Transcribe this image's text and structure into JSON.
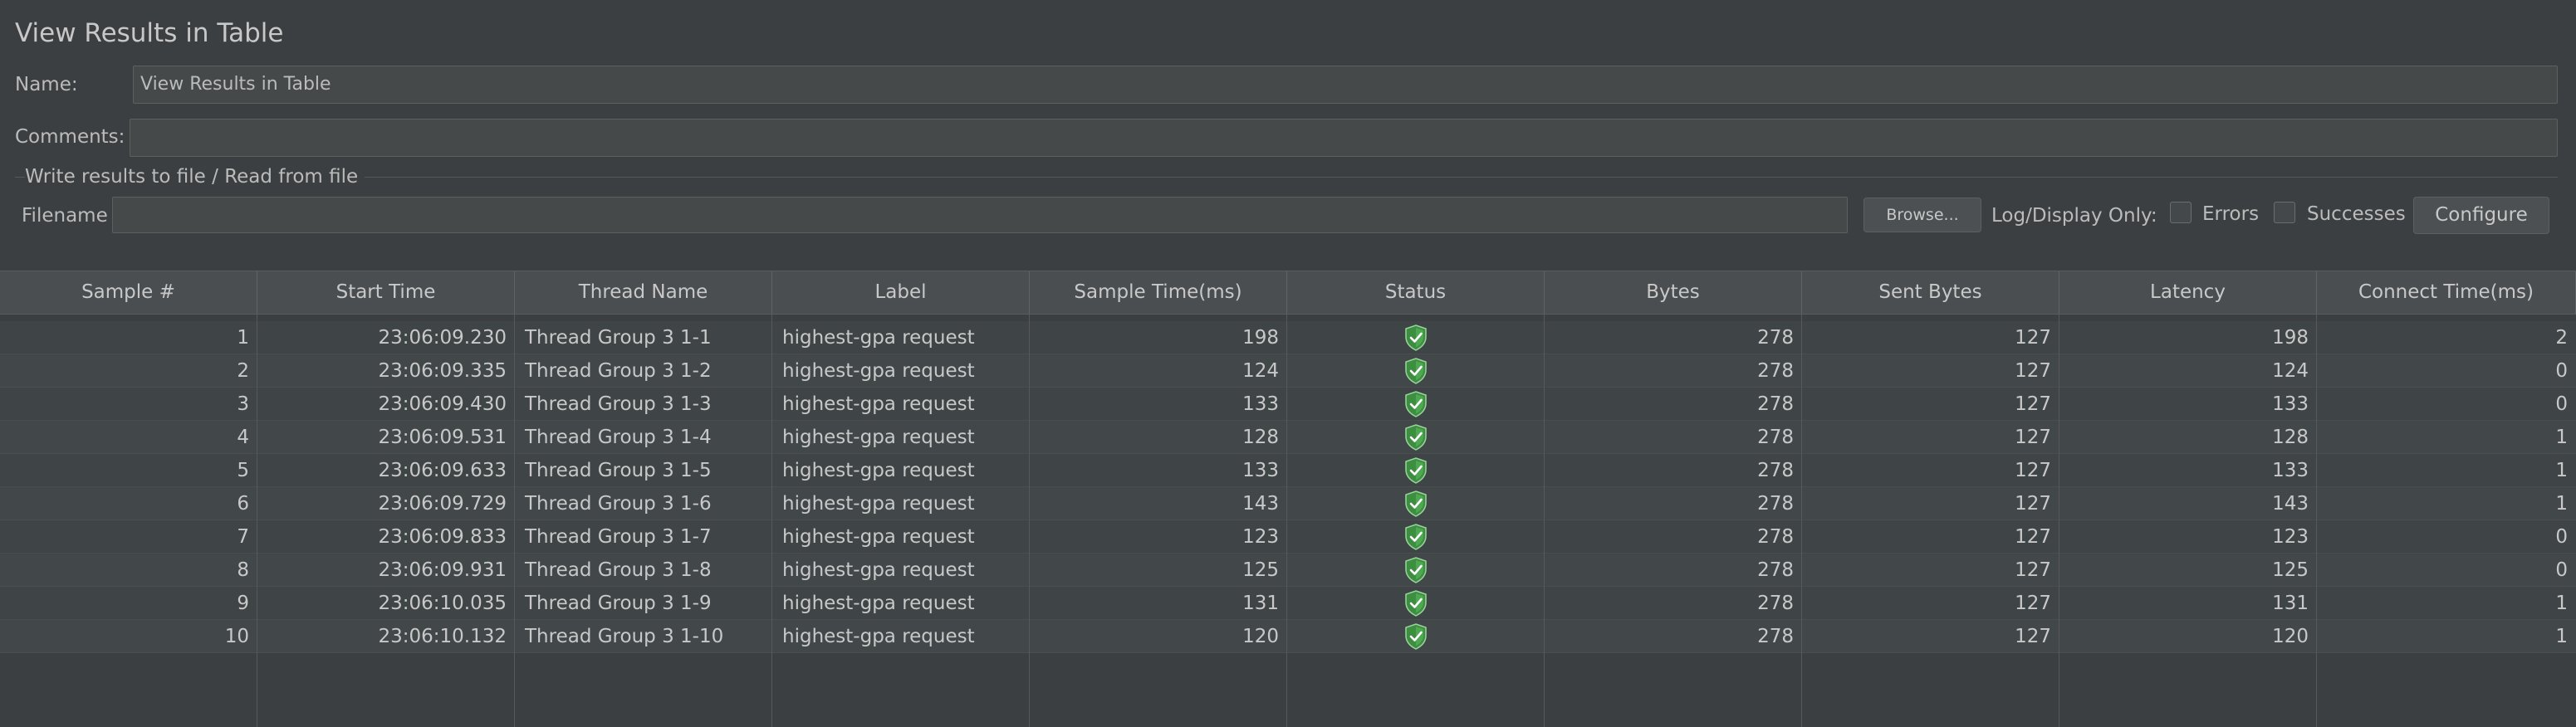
{
  "panel": {
    "title": "View Results in Table",
    "name_label": "Name:",
    "name_value": "View Results in Table",
    "comments_label": "Comments:",
    "comments_value": "",
    "file_section_title": "Write results to file / Read from file",
    "filename_label": "Filename",
    "filename_value": "",
    "browse_label": "Browse...",
    "log_display_label": "Log/Display Only:",
    "errors_label": "Errors",
    "errors_checked": false,
    "successes_label": "Successes",
    "successes_checked": false,
    "configure_label": "Configure"
  },
  "colors": {
    "background": "#3c3f41",
    "status_ok": "#4caf50"
  },
  "table": {
    "columns": [
      "Sample #",
      "Start Time",
      "Thread Name",
      "Label",
      "Sample Time(ms)",
      "Status",
      "Bytes",
      "Sent Bytes",
      "Latency",
      "Connect Time(ms)"
    ],
    "rows": [
      {
        "sample": "1",
        "start": "23:06:09.230",
        "thread": "Thread Group 3 1-1",
        "label": "highest-gpa request",
        "time": "198",
        "status_icon": "success-shield-icon",
        "bytes": "278",
        "sent": "127",
        "latency": "198",
        "connect": "2"
      },
      {
        "sample": "2",
        "start": "23:06:09.335",
        "thread": "Thread Group 3 1-2",
        "label": "highest-gpa request",
        "time": "124",
        "status_icon": "success-shield-icon",
        "bytes": "278",
        "sent": "127",
        "latency": "124",
        "connect": "0"
      },
      {
        "sample": "3",
        "start": "23:06:09.430",
        "thread": "Thread Group 3 1-3",
        "label": "highest-gpa request",
        "time": "133",
        "status_icon": "success-shield-icon",
        "bytes": "278",
        "sent": "127",
        "latency": "133",
        "connect": "0"
      },
      {
        "sample": "4",
        "start": "23:06:09.531",
        "thread": "Thread Group 3 1-4",
        "label": "highest-gpa request",
        "time": "128",
        "status_icon": "success-shield-icon",
        "bytes": "278",
        "sent": "127",
        "latency": "128",
        "connect": "1"
      },
      {
        "sample": "5",
        "start": "23:06:09.633",
        "thread": "Thread Group 3 1-5",
        "label": "highest-gpa request",
        "time": "133",
        "status_icon": "success-shield-icon",
        "bytes": "278",
        "sent": "127",
        "latency": "133",
        "connect": "1"
      },
      {
        "sample": "6",
        "start": "23:06:09.729",
        "thread": "Thread Group 3 1-6",
        "label": "highest-gpa request",
        "time": "143",
        "status_icon": "success-shield-icon",
        "bytes": "278",
        "sent": "127",
        "latency": "143",
        "connect": "1"
      },
      {
        "sample": "7",
        "start": "23:06:09.833",
        "thread": "Thread Group 3 1-7",
        "label": "highest-gpa request",
        "time": "123",
        "status_icon": "success-shield-icon",
        "bytes": "278",
        "sent": "127",
        "latency": "123",
        "connect": "0"
      },
      {
        "sample": "8",
        "start": "23:06:09.931",
        "thread": "Thread Group 3 1-8",
        "label": "highest-gpa request",
        "time": "125",
        "status_icon": "success-shield-icon",
        "bytes": "278",
        "sent": "127",
        "latency": "125",
        "connect": "0"
      },
      {
        "sample": "9",
        "start": "23:06:10.035",
        "thread": "Thread Group 3 1-9",
        "label": "highest-gpa request",
        "time": "131",
        "status_icon": "success-shield-icon",
        "bytes": "278",
        "sent": "127",
        "latency": "131",
        "connect": "1"
      },
      {
        "sample": "10",
        "start": "23:06:10.132",
        "thread": "Thread Group 3 1-10",
        "label": "highest-gpa request",
        "time": "120",
        "status_icon": "success-shield-icon",
        "bytes": "278",
        "sent": "127",
        "latency": "120",
        "connect": "1"
      }
    ]
  }
}
